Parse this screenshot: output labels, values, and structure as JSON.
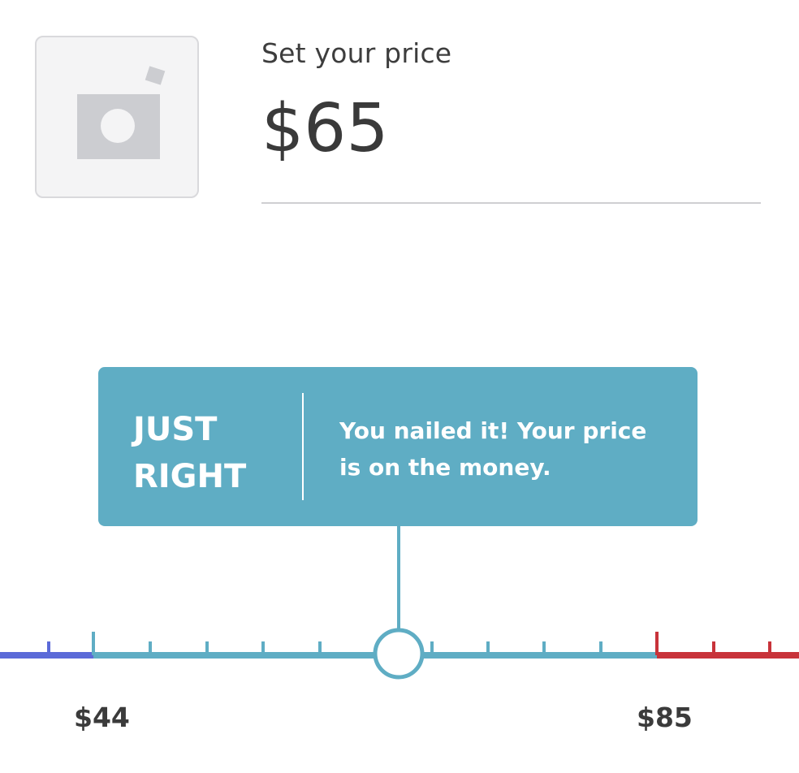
{
  "photo": {
    "icon": "camera-icon"
  },
  "price": {
    "label": "Set your price",
    "value": "$65"
  },
  "tooltip": {
    "title": "JUST RIGHT",
    "message": "You nailed it! Your price is on the money."
  },
  "slider": {
    "low_label": "$44",
    "high_label": "$85",
    "selected_value": 65,
    "colors": {
      "low": "#5b6ad8",
      "just_right": "#5fadc4",
      "high": "#c8333a"
    }
  }
}
